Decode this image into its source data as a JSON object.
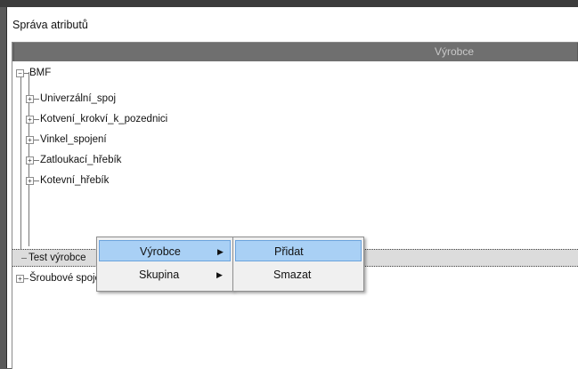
{
  "window": {
    "title": "Správa atributů"
  },
  "grid": {
    "column_header": "Výrobce"
  },
  "tree": {
    "root": {
      "label": "BMF",
      "expander": "−"
    },
    "children": [
      {
        "label": "Univerzální_spoj",
        "expander": "+"
      },
      {
        "label": "Kotvení_krokví_k_pozednici",
        "expander": "+"
      },
      {
        "label": "Vinkel_spojení",
        "expander": "+"
      },
      {
        "label": "Zatloukací_hřebík",
        "expander": "+"
      },
      {
        "label": "Kotevní_hřebík",
        "expander": "+"
      }
    ],
    "selected": {
      "label": "Test výrobce"
    },
    "last": {
      "label": "Šroubové spoje",
      "expander": "+"
    }
  },
  "context_menu": {
    "items": [
      {
        "label": "Výrobce",
        "arrow": "▶"
      },
      {
        "label": "Skupina",
        "arrow": "▶"
      }
    ]
  },
  "submenu": {
    "items": [
      {
        "label": "Přidat"
      },
      {
        "label": "Smazat"
      }
    ]
  }
}
